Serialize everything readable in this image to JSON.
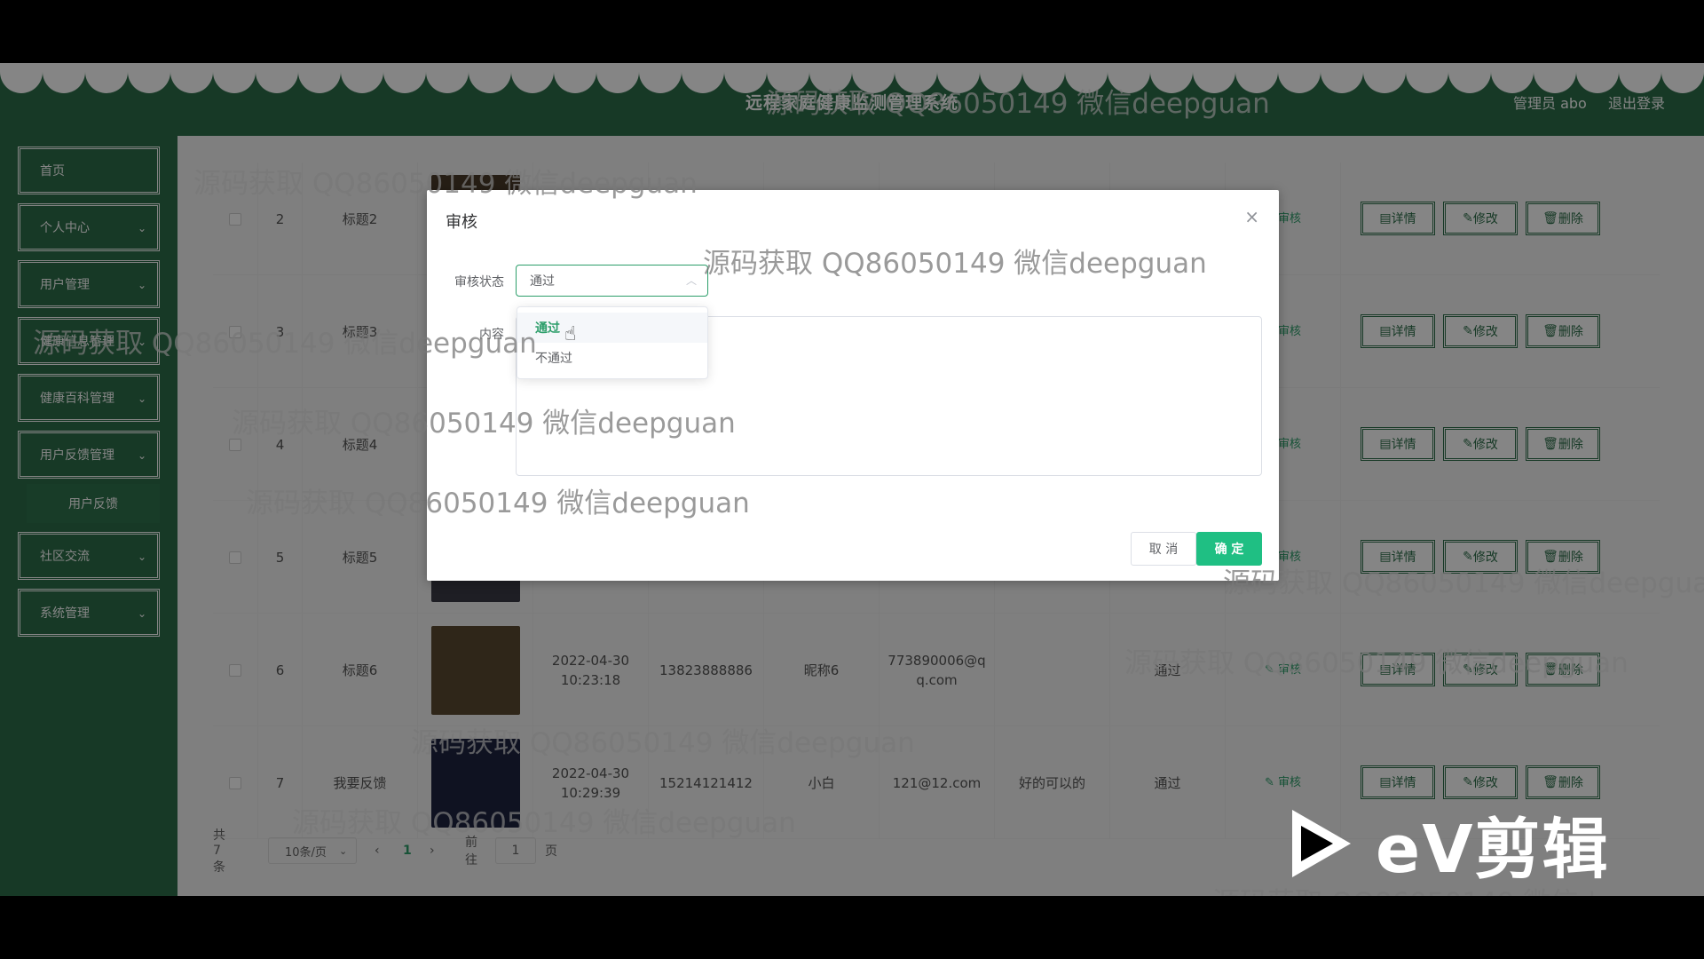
{
  "header": {
    "app_title": "远程家庭健康监测管理系统",
    "user": "管理员 abo",
    "logout": "退出登录"
  },
  "sidebar": {
    "items": [
      {
        "label": "首页"
      },
      {
        "label": "个人中心"
      },
      {
        "label": "用户管理"
      },
      {
        "label": "健康信息管理"
      },
      {
        "label": "健康百科管理"
      },
      {
        "label": "用户反馈管理"
      },
      {
        "label": "用户反馈"
      },
      {
        "label": "社区交流"
      },
      {
        "label": "系统管理"
      }
    ]
  },
  "table": {
    "rows": [
      {
        "index": "2",
        "title": "标题2",
        "time": "",
        "phone": "",
        "nickname": "",
        "email": "",
        "content": "",
        "status": ""
      },
      {
        "index": "3",
        "title": "标题3",
        "time": "",
        "phone": "",
        "nickname": "",
        "email": "",
        "content": "",
        "status": ""
      },
      {
        "index": "4",
        "title": "标题4",
        "time": "",
        "phone": "",
        "nickname": "",
        "email": "",
        "content": "",
        "status": ""
      },
      {
        "index": "5",
        "title": "标题5",
        "time": "",
        "phone": "",
        "nickname": "",
        "email": "",
        "content": "",
        "status": ""
      },
      {
        "index": "6",
        "title": "标题6",
        "time": "2022-04-30 10:23:18",
        "phone": "13823888886",
        "nickname": "昵称6",
        "email": "773890006@qq.com",
        "content": "",
        "status": "通过"
      },
      {
        "index": "7",
        "title": "我要反馈",
        "time": "2022-04-30 10:29:39",
        "phone": "15214121412",
        "nickname": "小白",
        "email": "121@12.com",
        "content": "好的可以的",
        "status": "通过"
      }
    ],
    "actions": {
      "review": "审核",
      "detail": "详情",
      "edit": "修改",
      "delete": "删除"
    }
  },
  "pager": {
    "total": "共 7 条",
    "page_size": "10条/页",
    "current": "1",
    "goto_label": "前往",
    "goto_value": "1",
    "page_suffix": "页"
  },
  "dialog": {
    "title": "审核",
    "status_label": "审核状态",
    "status_value": "通过",
    "content_label": "内容",
    "options": [
      "通过",
      "不通过"
    ],
    "cancel": "取 消",
    "confirm": "确 定"
  },
  "watermark": "源码获取 QQ86050149 微信deepguan",
  "ev_logo": "eV剪辑"
}
